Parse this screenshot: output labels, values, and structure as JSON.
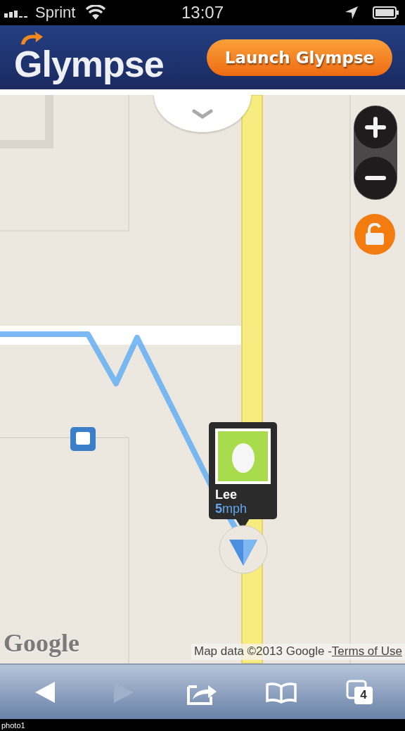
{
  "status_bar": {
    "carrier": "Sprint",
    "time": "13:07"
  },
  "header": {
    "logo": "Glympse",
    "button": "Launch Glympse"
  },
  "map": {
    "kind": "picture",
    "marker": {
      "name": "Lee",
      "speed": "**5**mph"
    },
    "google_logo": "Google",
    "attribution": {
      "text": "Map data ©2013 Google - ",
      "link": "Terms of Use"
    }
  },
  "toolbar": {
    "buttons": [
      {
        "kind": "back",
        "disabled": false
      },
      {
        "kind": "forward",
        "disabled": true
      },
      {
        "kind": "share",
        "disabled": false
      },
      {
        "kind": "bookmarks",
        "disabled": false
      },
      {
        "kind": "tabs",
        "disabled": false,
        "count": "4"
      }
    ]
  },
  "caption": "photo1"
}
